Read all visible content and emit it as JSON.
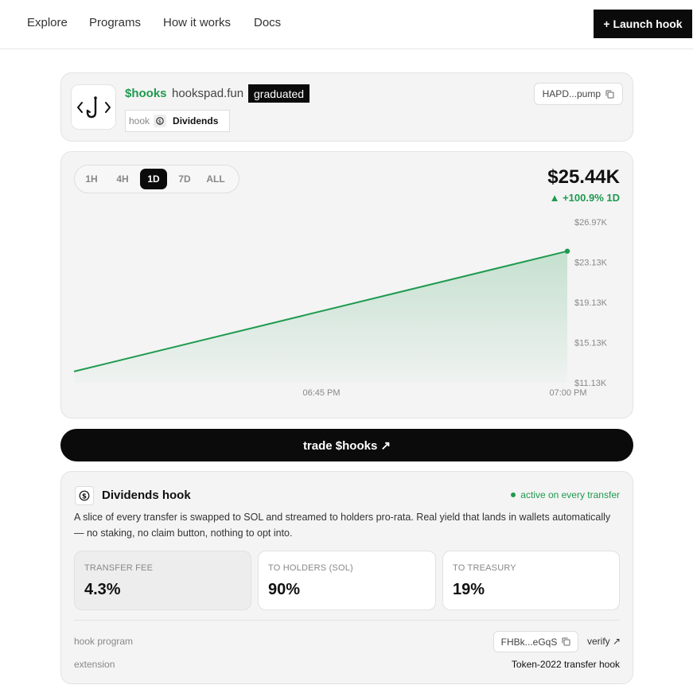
{
  "nav": {
    "links": [
      "Explore",
      "Programs",
      "How it works",
      "Docs"
    ],
    "launch_label": "+ Launch hook"
  },
  "token": {
    "ticker": "$hooks",
    "site": "hookspad.fun",
    "status_badge": "graduated",
    "hook_label": "hook",
    "hook_name": "Dividends",
    "address": "HAPD...pump"
  },
  "chart": {
    "timeframes": [
      "1H",
      "4H",
      "1D",
      "7D",
      "ALL"
    ],
    "active_timeframe": "1D",
    "price": "$25.44K",
    "change": "+100.9% 1D",
    "color": "#1e9a4f"
  },
  "chart_data": {
    "type": "area",
    "x": [
      "06:33 PM",
      "07:00 PM"
    ],
    "y": [
      12.35,
      25.44
    ],
    "y_unit": "$K",
    "xticks": [
      "06:45 PM",
      "07:00 PM"
    ],
    "yticks": [
      "$26.97K",
      "$23.13K",
      "$19.13K",
      "$15.13K",
      "$11.13K"
    ],
    "ylim": [
      11.13,
      26.97
    ],
    "grid": false
  },
  "trade": {
    "label": "trade $hooks ↗"
  },
  "dividends": {
    "title": "Dividends hook",
    "status": "active on every transfer",
    "description": "A slice of every transfer is swapped to SOL and streamed to holders pro-rata. Real yield that lands in wallets automatically — no staking, no claim button, nothing to opt into.",
    "stats": [
      {
        "label": "TRANSFER FEE",
        "value": "4.3%"
      },
      {
        "label": "TO HOLDERS (SOL)",
        "value": "90%"
      },
      {
        "label": "TO TREASURY",
        "value": "19%"
      }
    ],
    "program_label": "hook program",
    "program_address": "FHBk...eGqS",
    "verify_label": "verify ↗",
    "extension_label": "extension",
    "extension_value": "Token-2022 transfer hook"
  }
}
